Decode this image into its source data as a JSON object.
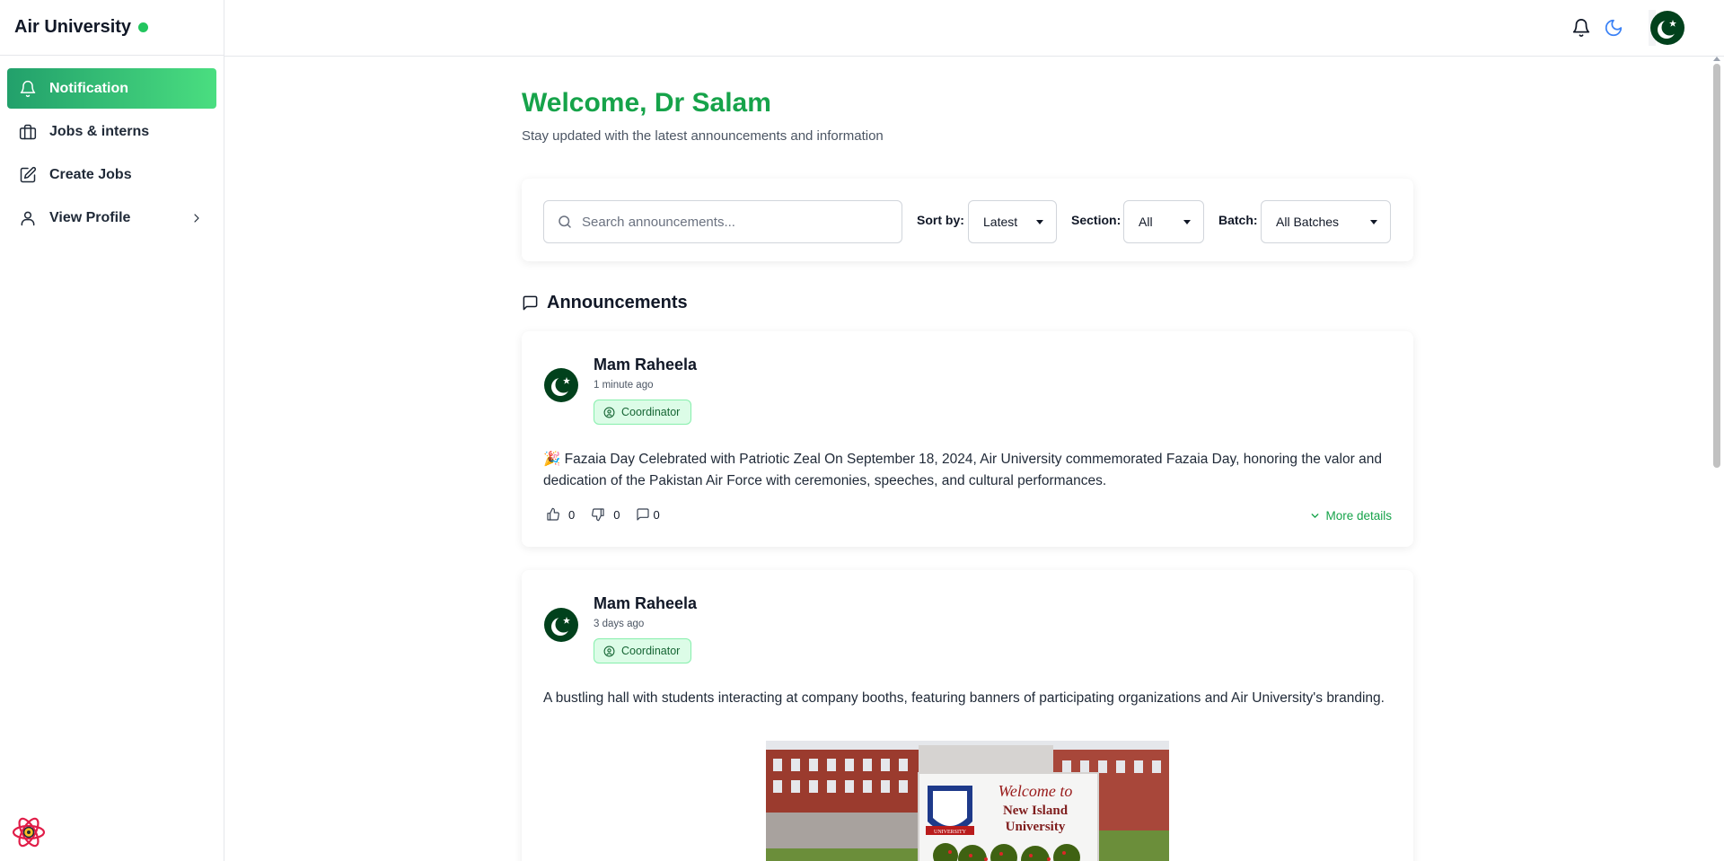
{
  "brand": {
    "name": "Air University",
    "status_color": "#22c55e"
  },
  "sidebar": {
    "items": [
      {
        "label": "Notification",
        "icon": "bell-icon",
        "active": true
      },
      {
        "label": "Jobs & interns",
        "icon": "briefcase-icon",
        "active": false
      },
      {
        "label": "Create Jobs",
        "icon": "edit-icon",
        "active": false
      },
      {
        "label": "View Profile",
        "icon": "user-icon",
        "active": false
      }
    ]
  },
  "topbar": {
    "icons": [
      "bell-icon",
      "moon-icon",
      "avatar"
    ]
  },
  "header": {
    "welcome": "Welcome, Dr Salam",
    "subtitle": "Stay updated with the latest announcements and information"
  },
  "filters": {
    "search_placeholder": "Search announcements...",
    "sort_label": "Sort by:",
    "sort_value": "Latest",
    "section_label": "Section:",
    "section_value": "All",
    "batch_label": "Batch:",
    "batch_value": "All Batches"
  },
  "announcements": {
    "title": "Announcements",
    "posts": [
      {
        "author": "Mam Raheela",
        "time": "1 minute ago",
        "role": "Coordinator",
        "content": "🎉 Fazaia Day Celebrated with Patriotic Zeal On September 18, 2024, Air University commemorated Fazaia Day, honoring the valor and dedication of the Pakistan Air Force with ceremonies, speeches, and cultural performances.",
        "likes": "0",
        "dislikes": "0",
        "comments": "0",
        "more_label": "More details"
      },
      {
        "author": "Mam Raheela",
        "time": "3 days ago",
        "role": "Coordinator",
        "content": "A bustling hall with students interacting at company booths, featuring banners of participating organizations and Air University's branding.",
        "image_text_line1": "Welcome to",
        "image_text_line2": "New Island",
        "image_text_line3": "University",
        "image_seal_text": "UNIVERSITY"
      }
    ]
  },
  "colors": {
    "accent": "#16a34a",
    "badge_bg": "#dcfce7",
    "flag_green": "#01411c"
  }
}
